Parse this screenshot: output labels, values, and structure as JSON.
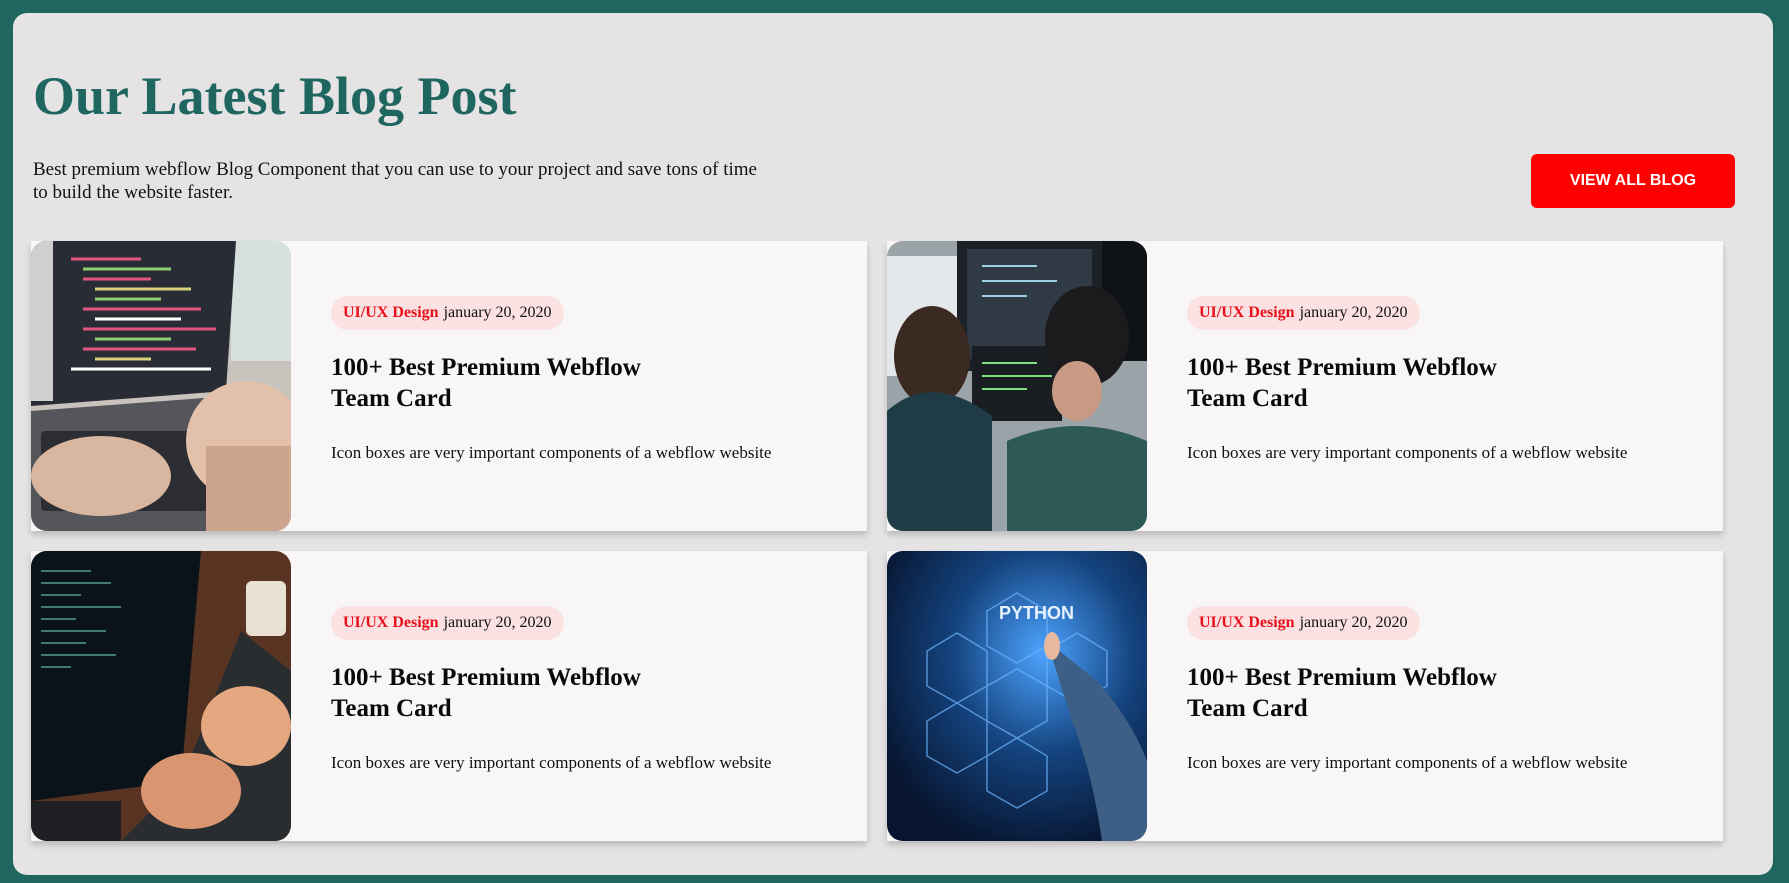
{
  "header": {
    "title": "Our Latest Blog Post",
    "intro": "Best premium webflow Blog Component that you can use to your project and save tons of time to build the website faster.",
    "view_all_label": "VIEW ALL BLOG"
  },
  "colors": {
    "page_bg": "#1f6660",
    "panel_bg": "#e5e3e4",
    "accent_button": "#fe0000",
    "category_text": "#e8101a",
    "tag_bg": "#fbe1e2",
    "title_color": "#1f6660"
  },
  "posts": [
    {
      "category": "UI/UX Design",
      "date": "january 20, 2020",
      "title": "100+ Best Premium Webflow Team Card",
      "description": "Icon boxes are very important components of a webflow website",
      "image": "laptop-code-photo"
    },
    {
      "category": "UI/UX Design",
      "date": "january 20, 2020",
      "title": "100+ Best Premium Webflow Team Card",
      "description": "Icon boxes are very important components of a webflow website",
      "image": "developers-monitors-photo"
    },
    {
      "category": "UI/UX Design",
      "date": "january 20, 2020",
      "title": "100+ Best Premium Webflow Team Card",
      "description": "Icon boxes are very important components of a webflow website",
      "image": "typing-laptop-coffee-photo"
    },
    {
      "category": "UI/UX Design",
      "date": "january 20, 2020",
      "title": "100+ Best Premium Webflow Team Card",
      "description": "Icon boxes are very important components of a webflow website",
      "image": "python-touchscreen-photo",
      "image_text": "PYTHON"
    }
  ]
}
